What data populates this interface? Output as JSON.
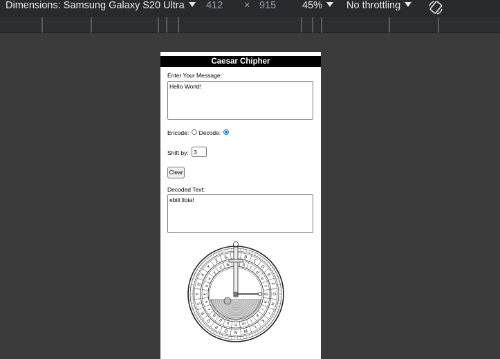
{
  "toolbar": {
    "dimensions_label": "Dimensions: Samsung Galaxy S20 Ultra",
    "width_value": "412",
    "times": "×",
    "height_value": "915",
    "zoom": "45%",
    "throttling": "No throttling",
    "rotate_icon": "rotate-device-icon"
  },
  "app": {
    "title": "Caesar Chipher",
    "message_label": "Enter Your Message:",
    "message_value": "Hello World!",
    "encode_label": "Encode:",
    "decode_label": "Decode:",
    "encode_checked": false,
    "decode_checked": true,
    "shift_label": "Shift by:",
    "shift_value": "3",
    "clear_label": "Clear",
    "output_label": "Decoded Text:",
    "output_value": "ebiil tloia!",
    "wheel_icon": "cipher-wheel-image",
    "outer_ring_letters": [
      "A",
      "B",
      "C",
      "D",
      "E",
      "F",
      "G",
      "H",
      "I",
      "K",
      "L",
      "M",
      "N",
      "O",
      "P",
      "Q",
      "R",
      "S",
      "T",
      "U",
      "X",
      "Y",
      "Z",
      "&"
    ],
    "inner_ring_letters": [
      "a",
      "b",
      "c",
      "d",
      "e",
      "f",
      "g",
      "h",
      "i",
      "k",
      "l",
      "m",
      "n",
      "o",
      "p",
      "q",
      "r",
      "s",
      "t",
      "u",
      "x",
      "y",
      "z",
      "&"
    ]
  }
}
